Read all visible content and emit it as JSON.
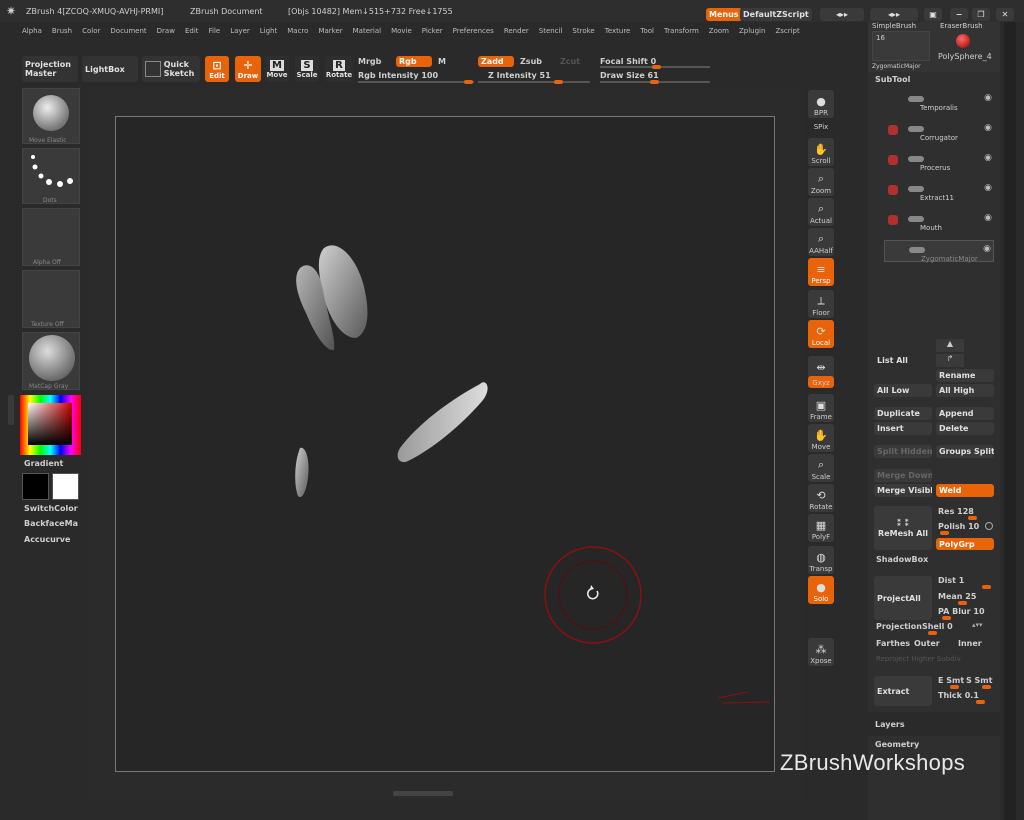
{
  "titlebar": {
    "app": "ZBrush 4[ZCOQ-XMUQ-AVHJ-PRMI]",
    "doc": "ZBrush Document",
    "stats": "[Objs 10482]  Mem↓515+732  Free↓1755",
    "menus_btn": "Menus",
    "script_btn": "DefaultZScript"
  },
  "menubar": [
    "Alpha",
    "Brush",
    "Color",
    "Document",
    "Draw",
    "Edit",
    "File",
    "Layer",
    "Light",
    "Macro",
    "Marker",
    "Material",
    "Movie",
    "Picker",
    "Preferences",
    "Render",
    "Stencil",
    "Stroke",
    "Texture",
    "Tool",
    "Transform",
    "Zoom",
    "Zplugin",
    "Zscript"
  ],
  "toolbar": {
    "projection_master": "Projection Master",
    "lightbox": "LightBox",
    "quick_sketch": "Quick Sketch",
    "edit": "Edit",
    "draw": "Draw",
    "move": "Move",
    "scale": "Scale",
    "rotate": "Rotate",
    "mrgb": "Mrgb",
    "rgb": "Rgb",
    "m": "M",
    "rgb_intensity": "Rgb Intensity 100",
    "zadd": "Zadd",
    "zsub": "Zsub",
    "zcut": "Zcut",
    "z_intensity": "Z Intensity 51",
    "focal_shift": "Focal Shift 0",
    "draw_size": "Draw Size 61",
    "rgb_intensity_value": 100,
    "z_intensity_value": 51,
    "focal_shift_value": 0,
    "draw_size_value": 61
  },
  "left_shelf": {
    "brush_label": "Move Elastic",
    "stroke_label": "Dots",
    "alpha_label": "Alpha Off",
    "texture_label": "Texture Off",
    "material_label": "MatCap Gray",
    "gradient": "Gradient",
    "switchcolor": "SwitchColor",
    "backface": "BackfaceMa",
    "accucurve": "Accucurve"
  },
  "right_shelf": [
    {
      "name": "bpr",
      "label": "BPR"
    },
    {
      "name": "spix",
      "label": "SPix"
    },
    {
      "name": "scroll",
      "label": "Scroll"
    },
    {
      "name": "zoom",
      "label": "Zoom"
    },
    {
      "name": "actual",
      "label": "Actual"
    },
    {
      "name": "aahalf",
      "label": "AAHalf"
    },
    {
      "name": "persp",
      "label": "Persp"
    },
    {
      "name": "floor",
      "label": "Floor"
    },
    {
      "name": "local",
      "label": "Local"
    },
    {
      "name": "lsym",
      "label": "L.Sym"
    },
    {
      "name": "xyz",
      "label": "Gxyz"
    },
    {
      "name": "frame",
      "label": "Frame"
    },
    {
      "name": "move",
      "label": "Move"
    },
    {
      "name": "scale",
      "label": "Scale"
    },
    {
      "name": "rotate",
      "label": "Rotate"
    },
    {
      "name": "polyf",
      "label": "PolyF"
    },
    {
      "name": "transp",
      "label": "Transp"
    },
    {
      "name": "solo",
      "label": "Solo"
    },
    {
      "name": "xpose",
      "label": "Xpose"
    }
  ],
  "tool_panel": {
    "simple_brush": "SimpleBrush",
    "eraser_brush": "EraserBrush",
    "count": "16",
    "zygomatic": "ZygomaticMajor",
    "polysphere": "PolySphere_4"
  },
  "subtool": {
    "header": "SubTool",
    "items": [
      "Temporalis",
      "Corrugator",
      "Procerus",
      "Extract11",
      "Mouth",
      "ZygomaticMajor"
    ],
    "list_all": "List All",
    "rename": "Rename",
    "all_low": "All Low",
    "all_high": "All High",
    "duplicate": "Duplicate",
    "append": "Append",
    "insert": "Insert",
    "delete": "Delete",
    "split_hidden": "Split Hidden",
    "groups_split": "Groups Split",
    "merge_down": "Merge Down",
    "merge_visible": "Merge Visibl",
    "weld": "Weld",
    "remesh_all": "ReMesh All",
    "res": "Res 128",
    "polish": "Polish 10",
    "polygrp": "PolyGrp",
    "shadowbox": "ShadowBox",
    "project_all": "ProjectAll",
    "dist": "Dist 1",
    "mean": "Mean 25",
    "pa_blur": "PA Blur 10",
    "projection_shell": "ProjectionShell 0",
    "farthest": "Farthes",
    "outer": "Outer",
    "inner": "Inner",
    "reproject_higher": "Reproject Higher Subdiv",
    "extract": "Extract",
    "e_smt": "E Smt",
    "s_smt": "S Smt",
    "thick": "Thick 0.1",
    "layers": "Layers",
    "geometry": "Geometry"
  },
  "watermark": "ZBrushWorkshops"
}
